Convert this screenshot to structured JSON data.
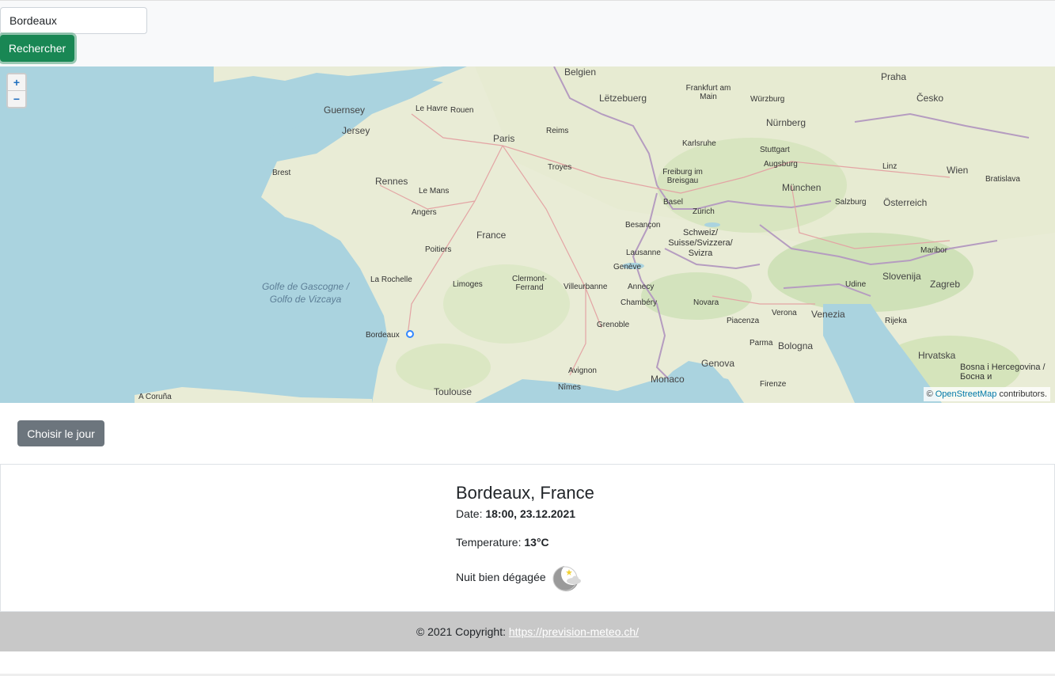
{
  "search": {
    "value": "Bordeaux",
    "button_label": "Rechercher"
  },
  "map": {
    "zoom_in": "+",
    "zoom_out": "−",
    "attribution_prefix": "©",
    "attribution_link": "OpenStreetMap",
    "attribution_suffix": "contributors.",
    "labels": {
      "belgien": "Belgien",
      "letzebuerg": "Lëtzebuerg",
      "frankfurt": "Frankfurt am Main",
      "wurzburg": "Würzburg",
      "praha": "Praha",
      "cesko": "Česko",
      "nurnberg": "Nürnberg",
      "paris": "Paris",
      "reims": "Reims",
      "rouen": "Rouen",
      "lehavre": "Le Havre",
      "guernsey": "Guernsey",
      "jersey": "Jersey",
      "brest": "Brest",
      "rennes": "Rennes",
      "lemans": "Le Mans",
      "angers": "Angers",
      "troyes": "Troyes",
      "france": "France",
      "poitiers": "Poitiers",
      "larochelle": "La Rochelle",
      "limoges": "Limoges",
      "clermont": "Clermont-Ferrand",
      "bordeaux": "Bordeaux",
      "toulouse": "Toulouse",
      "lyon": "Villeurbanne",
      "grenoble": "Grenoble",
      "geneve": "Genève",
      "lausanne": "Lausanne",
      "schweiz": "Schweiz/ Suisse/Svizzera/ Svizra",
      "munchen": "München",
      "wien": "Wien",
      "bratislava": "Bratislava",
      "osterreich": "Österreich",
      "slovenija": "Slovenija",
      "zagreb": "Zagreb",
      "hrvatska": "Hrvatska",
      "venezia": "Venezia",
      "verona": "Verona",
      "bologna": "Bologna",
      "genova": "Genova",
      "monaco": "Monaco",
      "nimes": "Nîmes",
      "avignon": "Avignon",
      "besancon": "Besançon",
      "zurich": "Zürich",
      "basel": "Basel",
      "freiburg": "Freiburg im Breisgau",
      "firenze": "Firenze",
      "golfe": "Golfe de Gascogne / Golfo de Vizcaya",
      "acoruna": "A Coruña",
      "bosna": "Bosna i Hercegovina / Босна и",
      "karlsruhe": "Karlsruhe",
      "stuttgart": "Stuttgart",
      "augsburg": "Augsburg",
      "salzburg": "Salzburg",
      "linz": "Linz",
      "graz": "Maribor",
      "udine": "Udine",
      "rijeka": "Rijeka",
      "milano": "Novara",
      "piacenza": "Piacenza",
      "parma": "Parma",
      "annecy": "Annecy",
      "chambery": "Chambéry"
    }
  },
  "day_button_label": "Choisir le jour",
  "weather": {
    "location": "Bordeaux, France",
    "date_label": "Date:",
    "date_value": "18:00, 23.12.2021",
    "temp_label": "Temperature:",
    "temp_value": "13°C",
    "condition": "Nuit bien dégagée",
    "icon": "moon-cloud-icon"
  },
  "footer": {
    "text": "© 2021 Copyright:",
    "link": "https://prevision-meteo.ch/"
  }
}
